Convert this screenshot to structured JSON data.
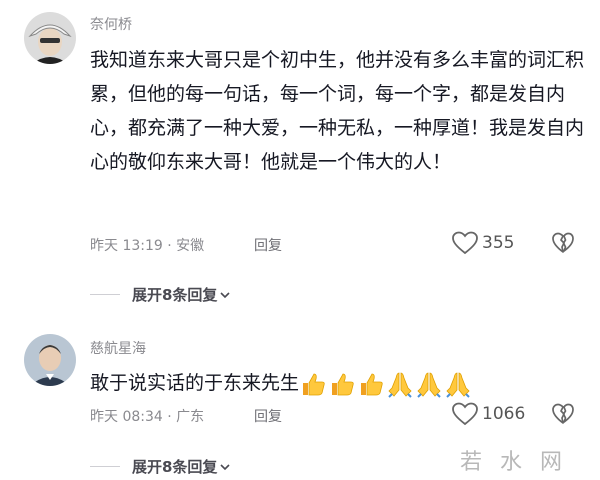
{
  "comments": [
    {
      "username": "奈何桥",
      "text": "我知道东来大哥只是个初中生，他并没有多么丰富的词汇积累，但他的每一句话，每一个词，每一个字，都是发自内心，都充满了一种大爱，一种无私，一种厚道！我是发自内心的敬仰东来大哥！他就是一个伟大的人！",
      "meta": "昨天 13:19 · 安徽",
      "reply_label": "回复",
      "likes": "355",
      "expand_label": "展开8条回复"
    },
    {
      "username": "慈航星海",
      "text": "敢于说实话的于东来先生",
      "emojis": [
        "thumbs-up",
        "thumbs-up",
        "thumbs-up",
        "praying-hands",
        "praying-hands",
        "praying-hands"
      ],
      "meta": "昨天 08:34 · 广东",
      "reply_label": "回复",
      "likes": "1066",
      "expand_label": "展开8条回复"
    }
  ],
  "watermark": "若水网",
  "colors": {
    "text": "#161823",
    "secondary": "#8a8a8f"
  }
}
